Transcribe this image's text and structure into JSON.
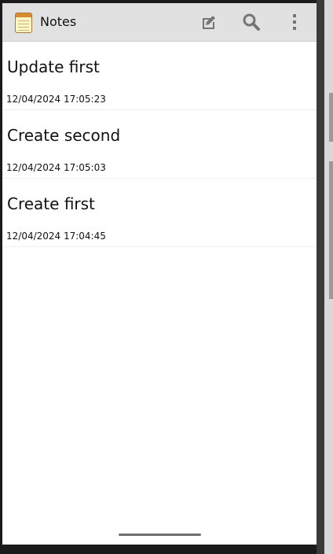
{
  "app": {
    "title": "Notes",
    "icon": "notepad-icon"
  },
  "actions": [
    {
      "name": "new-note-button",
      "icon": "new-note-icon"
    },
    {
      "name": "search-button",
      "icon": "search-icon"
    },
    {
      "name": "overflow-menu-button",
      "icon": "more-vert-icon"
    }
  ],
  "notes": [
    {
      "title": "Update first",
      "timestamp": "12/04/2024 17:05:23"
    },
    {
      "title": "Create second",
      "timestamp": "12/04/2024 17:05:03"
    },
    {
      "title": "Create first",
      "timestamp": "12/04/2024 17:04:45"
    }
  ],
  "colors": {
    "action_bar": "#e1e1e1",
    "icon_gray": "#757575",
    "background": "#ffffff"
  }
}
